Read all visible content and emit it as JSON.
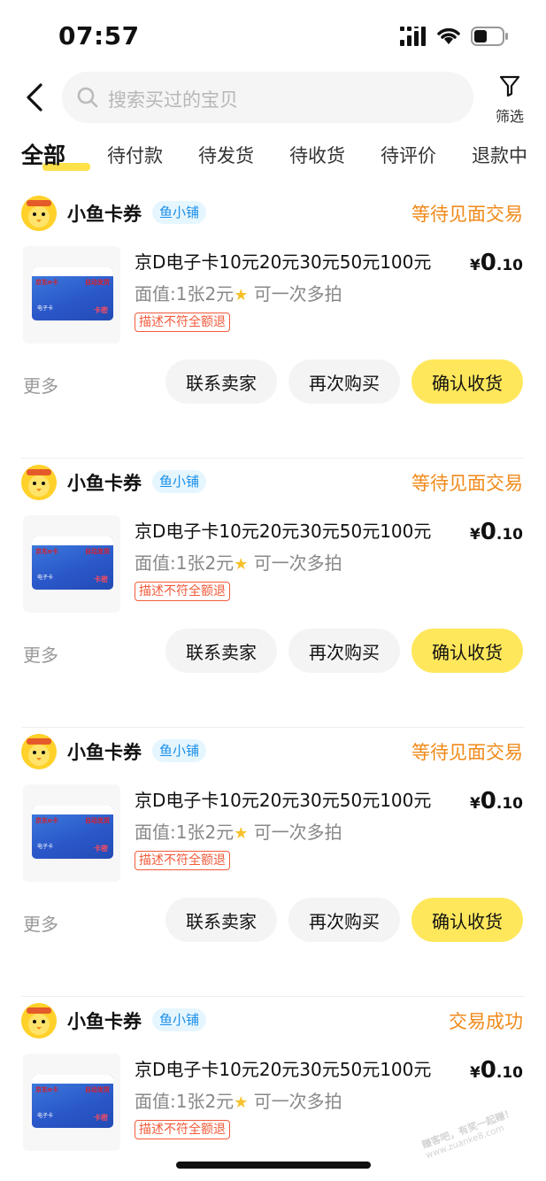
{
  "status_bar": {
    "time": "07:57"
  },
  "nav": {
    "search_placeholder": "搜索买过的宝贝",
    "filter_label": "筛选"
  },
  "tabs": [
    {
      "label": "全部"
    },
    {
      "label": "待付款"
    },
    {
      "label": "待发货"
    },
    {
      "label": "待收货"
    },
    {
      "label": "待评价"
    },
    {
      "label": "退款中"
    }
  ],
  "card_text": {
    "brand": "京东e卡",
    "auto": "自动发货",
    "key": "卡密",
    "ecard": "电子卡"
  },
  "orders": [
    {
      "shop": "小鱼卡券",
      "badge": "鱼小铺",
      "status": "等待见面交易",
      "title": "京D电子卡10元20元30元50元100元",
      "subtitle": "面值:1张2元",
      "subtitle_extra": "可一次多拍",
      "tag": "描述不符全额退",
      "price_symbol": "¥",
      "price_int": "0",
      "price_dec": ".10",
      "more": "更多",
      "btn_contact": "联系卖家",
      "btn_rebuy": "再次购买",
      "btn_confirm": "确认收货"
    },
    {
      "shop": "小鱼卡券",
      "badge": "鱼小铺",
      "status": "等待见面交易",
      "title": "京D电子卡10元20元30元50元100元",
      "subtitle": "面值:1张2元",
      "subtitle_extra": "可一次多拍",
      "tag": "描述不符全额退",
      "price_symbol": "¥",
      "price_int": "0",
      "price_dec": ".10",
      "more": "更多",
      "btn_contact": "联系卖家",
      "btn_rebuy": "再次购买",
      "btn_confirm": "确认收货"
    },
    {
      "shop": "小鱼卡券",
      "badge": "鱼小铺",
      "status": "等待见面交易",
      "title": "京D电子卡10元20元30元50元100元",
      "subtitle": "面值:1张2元",
      "subtitle_extra": "可一次多拍",
      "tag": "描述不符全额退",
      "price_symbol": "¥",
      "price_int": "0",
      "price_dec": ".10",
      "more": "更多",
      "btn_contact": "联系卖家",
      "btn_rebuy": "再次购买",
      "btn_confirm": "确认收货"
    },
    {
      "shop": "小鱼卡券",
      "badge": "鱼小铺",
      "status": "交易成功",
      "title": "京D电子卡10元20元30元50元100元",
      "subtitle": "面值:1张2元",
      "subtitle_extra": "可一次多拍",
      "tag": "描述不符全额退",
      "price_symbol": "¥",
      "price_int": "0",
      "price_dec": ".10"
    }
  ],
  "watermark": {
    "line1": "赚客吧，有奖一起赚！",
    "line2": "www.zuanke8.com"
  },
  "colors": {
    "accent_yellow": "#ffe75c",
    "status_orange": "#f08a1a",
    "tag_red": "#f25b3b",
    "badge_blue": "#1a8fe8"
  }
}
